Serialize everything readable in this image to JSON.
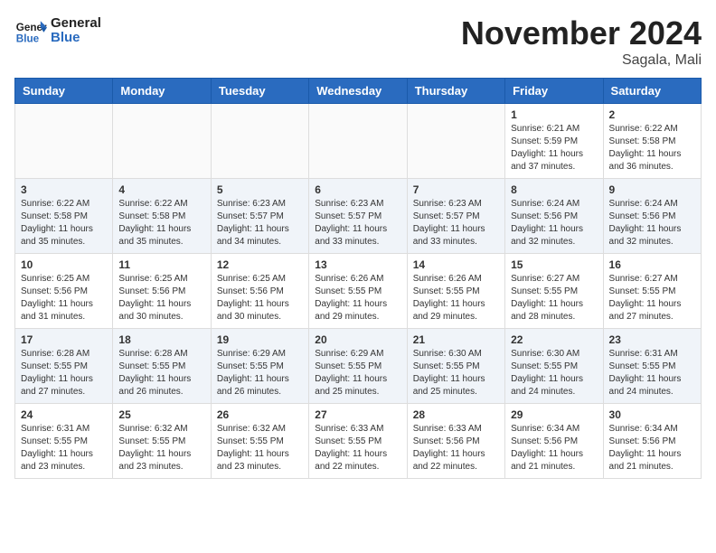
{
  "header": {
    "logo_line1": "General",
    "logo_line2": "Blue",
    "month": "November 2024",
    "location": "Sagala, Mali"
  },
  "weekdays": [
    "Sunday",
    "Monday",
    "Tuesday",
    "Wednesday",
    "Thursday",
    "Friday",
    "Saturday"
  ],
  "weeks": [
    [
      {
        "day": "",
        "info": ""
      },
      {
        "day": "",
        "info": ""
      },
      {
        "day": "",
        "info": ""
      },
      {
        "day": "",
        "info": ""
      },
      {
        "day": "",
        "info": ""
      },
      {
        "day": "1",
        "info": "Sunrise: 6:21 AM\nSunset: 5:59 PM\nDaylight: 11 hours\nand 37 minutes."
      },
      {
        "day": "2",
        "info": "Sunrise: 6:22 AM\nSunset: 5:58 PM\nDaylight: 11 hours\nand 36 minutes."
      }
    ],
    [
      {
        "day": "3",
        "info": "Sunrise: 6:22 AM\nSunset: 5:58 PM\nDaylight: 11 hours\nand 35 minutes."
      },
      {
        "day": "4",
        "info": "Sunrise: 6:22 AM\nSunset: 5:58 PM\nDaylight: 11 hours\nand 35 minutes."
      },
      {
        "day": "5",
        "info": "Sunrise: 6:23 AM\nSunset: 5:57 PM\nDaylight: 11 hours\nand 34 minutes."
      },
      {
        "day": "6",
        "info": "Sunrise: 6:23 AM\nSunset: 5:57 PM\nDaylight: 11 hours\nand 33 minutes."
      },
      {
        "day": "7",
        "info": "Sunrise: 6:23 AM\nSunset: 5:57 PM\nDaylight: 11 hours\nand 33 minutes."
      },
      {
        "day": "8",
        "info": "Sunrise: 6:24 AM\nSunset: 5:56 PM\nDaylight: 11 hours\nand 32 minutes."
      },
      {
        "day": "9",
        "info": "Sunrise: 6:24 AM\nSunset: 5:56 PM\nDaylight: 11 hours\nand 32 minutes."
      }
    ],
    [
      {
        "day": "10",
        "info": "Sunrise: 6:25 AM\nSunset: 5:56 PM\nDaylight: 11 hours\nand 31 minutes."
      },
      {
        "day": "11",
        "info": "Sunrise: 6:25 AM\nSunset: 5:56 PM\nDaylight: 11 hours\nand 30 minutes."
      },
      {
        "day": "12",
        "info": "Sunrise: 6:25 AM\nSunset: 5:56 PM\nDaylight: 11 hours\nand 30 minutes."
      },
      {
        "day": "13",
        "info": "Sunrise: 6:26 AM\nSunset: 5:55 PM\nDaylight: 11 hours\nand 29 minutes."
      },
      {
        "day": "14",
        "info": "Sunrise: 6:26 AM\nSunset: 5:55 PM\nDaylight: 11 hours\nand 29 minutes."
      },
      {
        "day": "15",
        "info": "Sunrise: 6:27 AM\nSunset: 5:55 PM\nDaylight: 11 hours\nand 28 minutes."
      },
      {
        "day": "16",
        "info": "Sunrise: 6:27 AM\nSunset: 5:55 PM\nDaylight: 11 hours\nand 27 minutes."
      }
    ],
    [
      {
        "day": "17",
        "info": "Sunrise: 6:28 AM\nSunset: 5:55 PM\nDaylight: 11 hours\nand 27 minutes."
      },
      {
        "day": "18",
        "info": "Sunrise: 6:28 AM\nSunset: 5:55 PM\nDaylight: 11 hours\nand 26 minutes."
      },
      {
        "day": "19",
        "info": "Sunrise: 6:29 AM\nSunset: 5:55 PM\nDaylight: 11 hours\nand 26 minutes."
      },
      {
        "day": "20",
        "info": "Sunrise: 6:29 AM\nSunset: 5:55 PM\nDaylight: 11 hours\nand 25 minutes."
      },
      {
        "day": "21",
        "info": "Sunrise: 6:30 AM\nSunset: 5:55 PM\nDaylight: 11 hours\nand 25 minutes."
      },
      {
        "day": "22",
        "info": "Sunrise: 6:30 AM\nSunset: 5:55 PM\nDaylight: 11 hours\nand 24 minutes."
      },
      {
        "day": "23",
        "info": "Sunrise: 6:31 AM\nSunset: 5:55 PM\nDaylight: 11 hours\nand 24 minutes."
      }
    ],
    [
      {
        "day": "24",
        "info": "Sunrise: 6:31 AM\nSunset: 5:55 PM\nDaylight: 11 hours\nand 23 minutes."
      },
      {
        "day": "25",
        "info": "Sunrise: 6:32 AM\nSunset: 5:55 PM\nDaylight: 11 hours\nand 23 minutes."
      },
      {
        "day": "26",
        "info": "Sunrise: 6:32 AM\nSunset: 5:55 PM\nDaylight: 11 hours\nand 23 minutes."
      },
      {
        "day": "27",
        "info": "Sunrise: 6:33 AM\nSunset: 5:55 PM\nDaylight: 11 hours\nand 22 minutes."
      },
      {
        "day": "28",
        "info": "Sunrise: 6:33 AM\nSunset: 5:56 PM\nDaylight: 11 hours\nand 22 minutes."
      },
      {
        "day": "29",
        "info": "Sunrise: 6:34 AM\nSunset: 5:56 PM\nDaylight: 11 hours\nand 21 minutes."
      },
      {
        "day": "30",
        "info": "Sunrise: 6:34 AM\nSunset: 5:56 PM\nDaylight: 11 hours\nand 21 minutes."
      }
    ]
  ]
}
